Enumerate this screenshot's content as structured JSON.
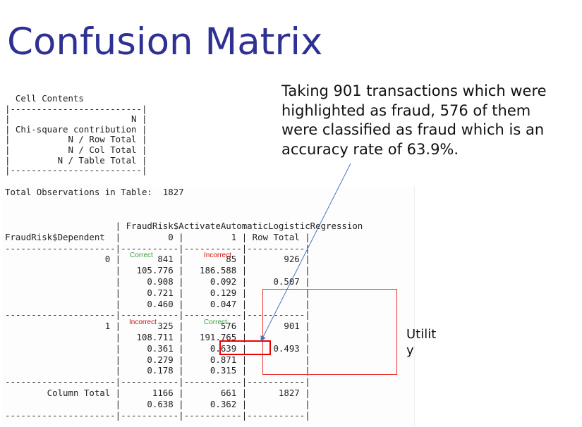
{
  "slide": {
    "title": "Confusion Matrix",
    "note": "Taking 901 transactions which were highlighted as fraud,  576 of them were classified as fraud which is an accuracy rate of 63.9%.",
    "utility_label": "Utility"
  },
  "output": {
    "cell_contents": "  Cell Contents\n|-------------------------|\n|                       N |\n| Chi-square contribution |\n|           N / Row Total |\n|           N / Col Total |\n|         N / Table Total |\n|-------------------------|",
    "total_observations": "Total Observations in Table:  1827",
    "crosstab": "                     | FraudRisk$ActivateAutomaticLogisticRegression\nFraudRisk$Dependent  |         0 |         1 | Row Total |\n---------------------|-----------|-----------|-----------|\n                   0 |       841 |        85 |       926 |\n                     |   105.776 |   186.588 |           |\n                     |     0.908 |     0.092 |     0.507 |\n                     |     0.721 |     0.129 |           |\n                     |     0.460 |     0.047 |           |\n---------------------|-----------|-----------|-----------|\n                   1 |       325 |       576 |       901 |\n                     |   108.711 |   191.765 |           |\n                     |     0.361 |     0.639 |     0.493 |\n                     |     0.279 |     0.871 |           |\n                     |     0.178 |     0.315 |           |\n---------------------|-----------|-----------|-----------|\n        Column Total |      1166 |       661 |      1827 |\n                     |     0.638 |     0.362 |           |\n---------------------|-----------|-----------|-----------|"
  },
  "tags": {
    "r0c0": "Correct",
    "r0c1": "Incorrect",
    "r1c0": "Incorrect",
    "r1c1": "Correct"
  },
  "colors": {
    "title": "#2e3192",
    "correct": "#3a9d3a",
    "incorrect": "#cc1111",
    "highlight": "#e00000",
    "arrow": "#4a72c4"
  }
}
